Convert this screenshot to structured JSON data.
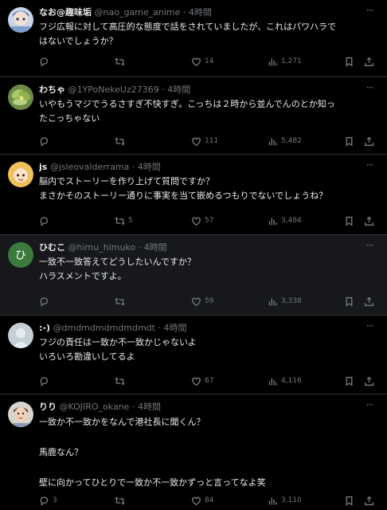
{
  "more_glyph": "···",
  "tweets": [
    {
      "name": "なお@趣味垢",
      "handle": "@nao_game_anime",
      "time": "4時間",
      "lines": [
        "フジ広報に対して高圧的な態度で話をされていましたが、これはパワハラで",
        "はないでしょうか？"
      ],
      "replies": "",
      "retweets": "",
      "likes": "14",
      "views": "1,271",
      "avatar_icon": "anime-avatar-icon"
    },
    {
      "name": "わちゃ",
      "handle": "@1YPoNekeUz27369",
      "time": "4時間",
      "lines": [
        "いやもうマジでうるさすぎ不快すぎ。こっちは２時から並んでんのとか知っ",
        "たこっちゃない"
      ],
      "replies": "",
      "retweets": "",
      "likes": "111",
      "views": "5,482",
      "avatar_icon": "plant-avatar-icon"
    },
    {
      "name": "js",
      "handle": "@jsleovalderrama",
      "time": "4時間",
      "lines": [
        "脳内でストーリーを作り上げて質問ですか？",
        "まさかそのストーリー通りに事実を当て嵌めるつもりでないでしょうね？"
      ],
      "replies": "",
      "retweets": "5",
      "likes": "57",
      "views": "3,484",
      "avatar_icon": "character-avatar-icon"
    },
    {
      "name": "ひむこ",
      "handle": "@himu_himuko",
      "time": "4時間",
      "lines": [
        "一致不一致答えてどうしたいんですか？",
        "ハラスメントですよ。"
      ],
      "replies": "",
      "retweets": "",
      "likes": "59",
      "views": "3,338",
      "avatar_letter": "ひ",
      "avatar_color": "#3b7a3c"
    },
    {
      "name": ":-)",
      "handle": "@dmdmdmdmdmdmdt",
      "time": "4時間",
      "lines": [
        "フジの責任は一致か不一致かじゃないよ",
        "いろいろ勘違いしてるよ"
      ],
      "replies": "",
      "retweets": "",
      "likes": "67",
      "views": "4,116",
      "avatar_icon": "default-avatar-icon"
    },
    {
      "name": "りり",
      "handle": "@KOJIRO_okane",
      "time": "4時間",
      "lines": [
        "一致か不一致かをなんで港社長に聞くん？",
        "",
        "馬鹿なん？",
        "",
        "壁に向かってひとりで一致か不一致かずっと言ってなよ笑"
      ],
      "replies": "3",
      "retweets": "",
      "likes": "84",
      "views": "3,110",
      "avatar_icon": "portrait-avatar-icon"
    }
  ]
}
